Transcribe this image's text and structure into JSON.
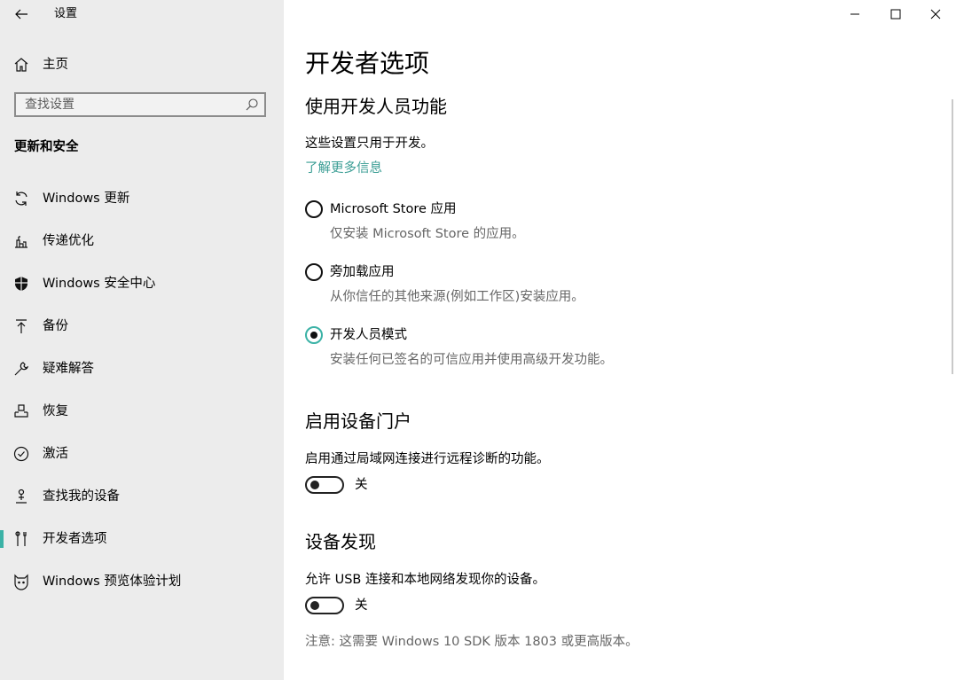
{
  "app": {
    "title": "设置"
  },
  "sidebar": {
    "home_label": "主页",
    "search_placeholder": "查找设置",
    "section_heading": "更新和安全",
    "items": [
      {
        "label": "Windows 更新",
        "icon": "sync-icon"
      },
      {
        "label": "传递优化",
        "icon": "delivery-optimization-icon"
      },
      {
        "label": "Windows 安全中心",
        "icon": "shield-icon"
      },
      {
        "label": "备份",
        "icon": "backup-arrow-icon"
      },
      {
        "label": "疑难解答",
        "icon": "wrench-icon"
      },
      {
        "label": "恢复",
        "icon": "recovery-icon"
      },
      {
        "label": "激活",
        "icon": "check-circle-icon"
      },
      {
        "label": "查找我的设备",
        "icon": "person-location-icon"
      },
      {
        "label": "开发者选项",
        "icon": "developer-tools-icon",
        "selected": true
      },
      {
        "label": "Windows 预览体验计划",
        "icon": "insider-cat-icon"
      }
    ],
    "accent_color": "#3bb2a6"
  },
  "main": {
    "page_title": "开发者选项",
    "dev_features": {
      "heading": "使用开发人员功能",
      "description": "这些设置只用于开发。",
      "learn_more": "了解更多信息",
      "options": [
        {
          "label": "Microsoft Store 应用",
          "description": "仅安装 Microsoft Store 的应用。",
          "checked": false
        },
        {
          "label": "旁加载应用",
          "description": "从你信任的其他来源(例如工作区)安装应用。",
          "checked": false
        },
        {
          "label": "开发人员模式",
          "description": "安装任何已签名的可信应用并使用高级开发功能。",
          "checked": true
        }
      ]
    },
    "device_portal": {
      "heading": "启用设备门户",
      "description": "启用通过局域网连接进行远程诊断的功能。",
      "toggle_state": "关"
    },
    "device_discovery": {
      "heading": "设备发现",
      "description": "允许 USB 连接和本地网络发现你的设备。",
      "toggle_state": "关",
      "note": "注意: 这需要 Windows 10 SDK 版本 1803 或更高版本。"
    }
  }
}
